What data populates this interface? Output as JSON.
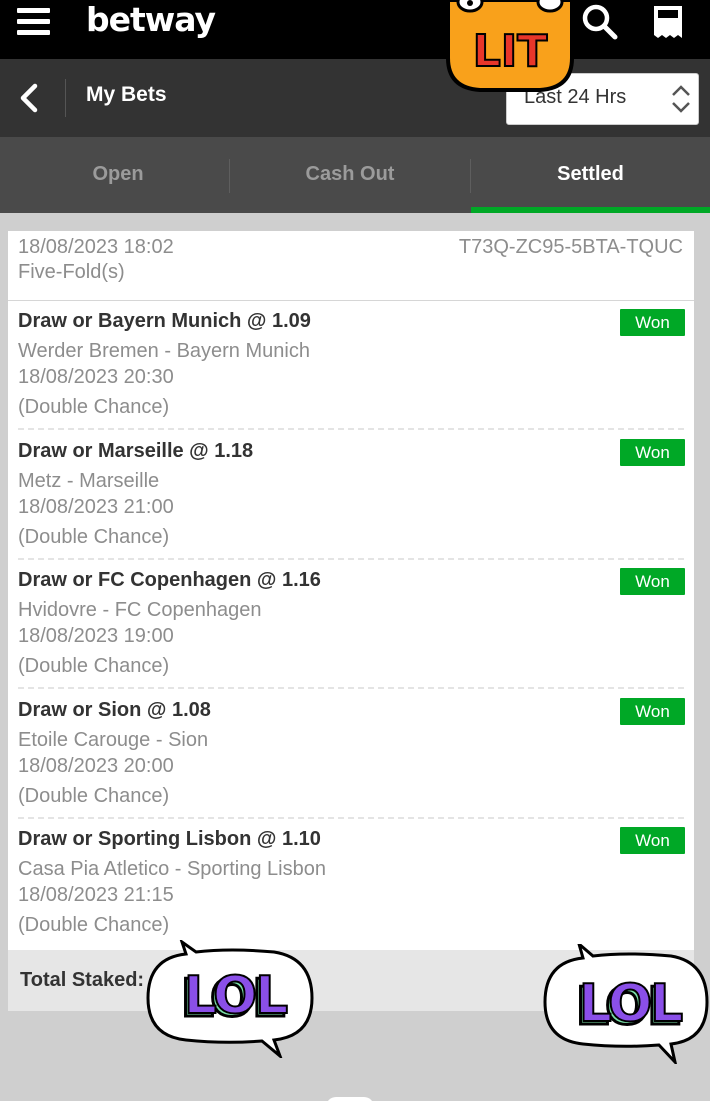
{
  "topbar": {
    "brand": "betway",
    "menu_icon": "hamburger-menu-icon",
    "search_icon": "search-icon",
    "betslip_icon": "betslip-icon"
  },
  "header": {
    "back_icon": "chevron-left-icon",
    "title": "My Bets",
    "range_selected": "Last 24 Hrs"
  },
  "tabs": [
    {
      "label": "Open",
      "active": false
    },
    {
      "label": "Cash Out",
      "active": false
    },
    {
      "label": "Settled",
      "active": true
    }
  ],
  "bet": {
    "placed": "18/08/2023 18:02",
    "type": "Five-Fold(s)",
    "reference": "T73Q-ZC95-5BTA-TQUC",
    "legs": [
      {
        "selection": "Draw or Bayern Munich @ 1.09",
        "match": "Werder Bremen - Bayern Munich",
        "time": "18/08/2023 20:30",
        "market": "(Double Chance)",
        "status": "Won"
      },
      {
        "selection": "Draw or Marseille @ 1.18",
        "match": "Metz - Marseille",
        "time": "18/08/2023 21:00",
        "market": "(Double Chance)",
        "status": "Won"
      },
      {
        "selection": "Draw or FC Copenhagen @ 1.16",
        "match": "Hvidovre - FC Copenhagen",
        "time": "18/08/2023 19:00",
        "market": "(Double Chance)",
        "status": "Won"
      },
      {
        "selection": "Draw or Sion @ 1.08",
        "match": "Etoile Carouge - Sion",
        "time": "18/08/2023 20:00",
        "market": "(Double Chance)",
        "status": "Won"
      },
      {
        "selection": "Draw or Sporting Lisbon @ 1.10",
        "match": "Casa Pia Atletico - Sporting Lisbon",
        "time": "18/08/2023 21:15",
        "market": "(Double Chance)",
        "status": "Won"
      }
    ],
    "total_staked_label": "Total Staked:"
  },
  "stickers": {
    "lit": "LIT",
    "lol": "LOL"
  },
  "colors": {
    "topbar": "#000000",
    "header": "#333333",
    "tabs": "#4a4a4a",
    "accent_green": "#00a826",
    "sticker_purple": "#8a4fe8",
    "sticker_green": "#7be0a8",
    "sticker_orange": "#f9a11b",
    "sticker_red": "#e8362a"
  }
}
